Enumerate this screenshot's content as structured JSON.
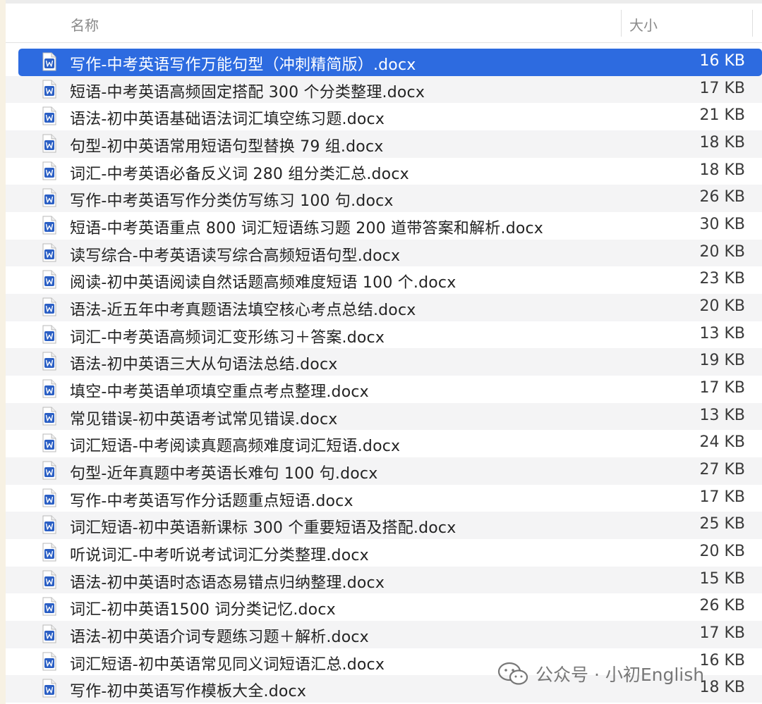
{
  "header": {
    "name_label": "名称",
    "size_label": "大小"
  },
  "files": [
    {
      "name": "写作-中考英语写作万能句型（冲刺精简版）.docx",
      "size": "16 KB",
      "selected": true
    },
    {
      "name": "短语-中考英语高频固定搭配 300 个分类整理.docx",
      "size": "17 KB"
    },
    {
      "name": "语法-初中英语基础语法词汇填空练习题.docx",
      "size": "21 KB"
    },
    {
      "name": "句型-初中英语常用短语句型替换 79 组.docx",
      "size": "18 KB"
    },
    {
      "name": "词汇-中考英语必备反义词 280 组分类汇总.docx",
      "size": "18 KB"
    },
    {
      "name": "写作-中考英语写作分类仿写练习 100 句.docx",
      "size": "26 KB"
    },
    {
      "name": "短语-中考英语重点 800 词汇短语练习题 200 道带答案和解析.docx",
      "size": "30 KB"
    },
    {
      "name": "读写综合-中考英语读写综合高频短语句型.docx",
      "size": "20 KB"
    },
    {
      "name": "阅读-初中英语阅读自然话题高频难度短语 100 个.docx",
      "size": "23 KB"
    },
    {
      "name": "语法-近五年中考真题语法填空核心考点总结.docx",
      "size": "20 KB"
    },
    {
      "name": "词汇-中考英语高频词汇变形练习＋答案.docx",
      "size": "13 KB"
    },
    {
      "name": "语法-初中英语三大从句语法总结.docx",
      "size": "19 KB"
    },
    {
      "name": "填空-中考英语单项填空重点考点整理.docx",
      "size": "17 KB"
    },
    {
      "name": "常见错误-初中英语考试常见错误.docx",
      "size": "13 KB"
    },
    {
      "name": "词汇短语-中考阅读真题高频难度词汇短语.docx",
      "size": "24 KB"
    },
    {
      "name": "句型-近年真题中考英语长难句 100 句.docx",
      "size": "27 KB"
    },
    {
      "name": "写作-中考英语写作分话题重点短语.docx",
      "size": "17 KB"
    },
    {
      "name": "词汇短语-初中英语新课标 300 个重要短语及搭配.docx",
      "size": "25 KB"
    },
    {
      "name": "听说词汇-中考听说考试词汇分类整理.docx",
      "size": "20 KB"
    },
    {
      "name": "语法-初中英语时态语态易错点归纳整理.docx",
      "size": "15 KB"
    },
    {
      "name": "词汇-初中英语1500 词分类记忆.docx",
      "size": "26 KB"
    },
    {
      "name": "语法-初中英语介词专题练习题＋解析.docx",
      "size": "17 KB"
    },
    {
      "name": "词汇短语-初中英语常见同义词短语汇总.docx",
      "size": "16 KB"
    },
    {
      "name": "写作-初中英语写作模板大全.docx",
      "size": "18 KB"
    }
  ],
  "watermark": {
    "text": "公众号 · 小初English"
  },
  "colors": {
    "selection": "#2d6be0",
    "row_alt": "#f4f4f5",
    "word_icon": "#2b5fc4"
  }
}
